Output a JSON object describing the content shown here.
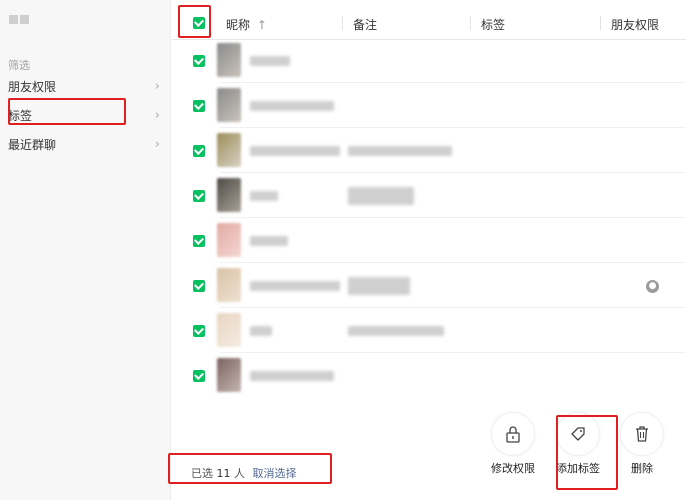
{
  "sidebar": {
    "filter_label": "筛选",
    "items": [
      {
        "label": "朋友权限"
      },
      {
        "label": "标签"
      },
      {
        "label": "最近群聊"
      }
    ]
  },
  "header": {
    "col_nickname": "昵称",
    "sort_arrow": "↑",
    "col_remark": "备注",
    "col_tag": "标签",
    "col_permission": "朋友权限"
  },
  "rows_selected": [
    true,
    true,
    true,
    true,
    true,
    true,
    true,
    true
  ],
  "footer": {
    "selected_prefix": "已选",
    "selected_count": "11",
    "selected_unit": "人",
    "cancel_label": "取消选择"
  },
  "actions": {
    "modify_permission": "修改权限",
    "add_tag": "添加标签",
    "delete": "删除"
  },
  "colors": {
    "accent": "#07c160",
    "highlight": "#e02020",
    "link": "#576b95"
  }
}
